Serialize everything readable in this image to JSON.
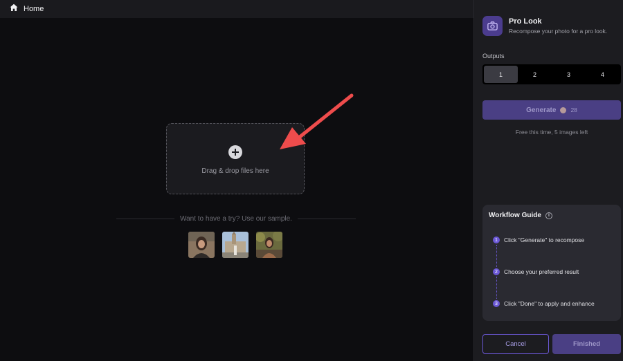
{
  "topbar": {
    "home_label": "Home"
  },
  "dropzone": {
    "text": "Drag & drop files here"
  },
  "samples": {
    "prompt": "Want to have a try? Use our sample.",
    "items": [
      "sample-portrait",
      "sample-landmark",
      "sample-street"
    ]
  },
  "tool": {
    "title": "Pro Look",
    "subtitle": "Recompose your photo for a pro look.",
    "icon": "camera-icon",
    "accent": "#6b58d6"
  },
  "outputs": {
    "label": "Outputs",
    "options": [
      "1",
      "2",
      "3",
      "4"
    ],
    "selected": "1"
  },
  "generate": {
    "label": "Generate",
    "cost": "28",
    "note": "Free this time, 5 images left"
  },
  "guide": {
    "title": "Workflow Guide",
    "steps": [
      {
        "num": "1",
        "text": "Click \"Generate\" to recompose"
      },
      {
        "num": "2",
        "text": "Choose your preferred result"
      },
      {
        "num": "3",
        "text": "Click \"Done\" to apply and enhance"
      }
    ]
  },
  "footer": {
    "cancel_label": "Cancel",
    "finish_label": "Finished"
  }
}
